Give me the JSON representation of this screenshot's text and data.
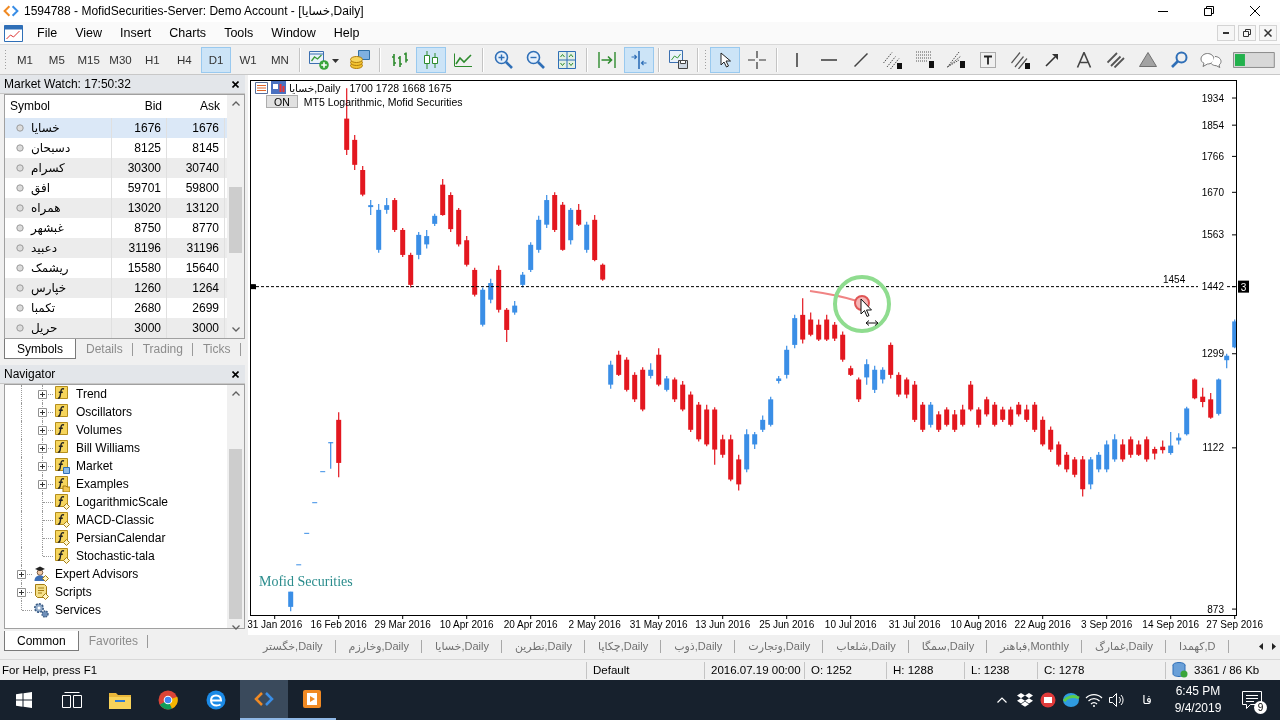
{
  "window": {
    "title": "1594788 - MofidSecurities-Server: Demo Account - [خسايا,Daily]"
  },
  "menu": [
    "File",
    "View",
    "Insert",
    "Charts",
    "Tools",
    "Window",
    "Help"
  ],
  "toolbar": {
    "timeframes": [
      {
        "label": "M1",
        "selected": false
      },
      {
        "label": "M5",
        "selected": false
      },
      {
        "label": "M15",
        "selected": false
      },
      {
        "label": "M30",
        "selected": false
      },
      {
        "label": "H1",
        "selected": false
      },
      {
        "label": "H4",
        "selected": false
      },
      {
        "label": "D1",
        "selected": true
      },
      {
        "label": "W1",
        "selected": false
      },
      {
        "label": "MN",
        "selected": false
      }
    ],
    "chart_types": [
      {
        "kind": "bars",
        "selected": false
      },
      {
        "kind": "candles",
        "selected": true
      },
      {
        "kind": "line",
        "selected": false
      }
    ],
    "scroll_modes": [
      {
        "kind": "autoscroll",
        "selected": false
      },
      {
        "kind": "shift",
        "selected": true
      }
    ],
    "cursor_modes": [
      {
        "kind": "cursor",
        "selected": true
      },
      {
        "kind": "crosshair",
        "selected": false
      }
    ]
  },
  "market_watch": {
    "title": "Market Watch: 17:50:32",
    "columns": [
      "Symbol",
      "Bid",
      "Ask"
    ],
    "rows": [
      {
        "symbol": "خسايا",
        "bid": "1676",
        "ask": "1676",
        "selected": true
      },
      {
        "symbol": "دسبحان",
        "bid": "8125",
        "ask": "8145",
        "selected": false
      },
      {
        "symbol": "كسرام",
        "bid": "30300",
        "ask": "30740",
        "selected": false
      },
      {
        "symbol": "افق",
        "bid": "59701",
        "ask": "59800",
        "selected": false
      },
      {
        "symbol": "همراه",
        "bid": "13020",
        "ask": "13120",
        "selected": false
      },
      {
        "symbol": "غبشهر",
        "bid": "8750",
        "ask": "8770",
        "selected": false
      },
      {
        "symbol": "دعبيد",
        "bid": "31196",
        "ask": "31196",
        "selected": false
      },
      {
        "symbol": "ريشمک",
        "bid": "15580",
        "ask": "15640",
        "selected": false
      },
      {
        "symbol": "خپارس",
        "bid": "1260",
        "ask": "1264",
        "selected": false
      },
      {
        "symbol": "تکمبا",
        "bid": "2680",
        "ask": "2699",
        "selected": false
      },
      {
        "symbol": "حريل",
        "bid": "3000",
        "ask": "3000",
        "selected": false
      }
    ],
    "tabs": [
      {
        "label": "Symbols",
        "selected": true
      },
      {
        "label": "Details",
        "selected": false
      },
      {
        "label": "Trading",
        "selected": false
      },
      {
        "label": "Ticks",
        "selected": false
      }
    ]
  },
  "navigator": {
    "title": "Navigator",
    "tree": [
      {
        "children": [
          {
            "label": "Trend",
            "kind": "group",
            "expanded": false
          },
          {
            "label": "Oscillators",
            "kind": "group",
            "expanded": false
          },
          {
            "label": "Volumes",
            "kind": "group",
            "expanded": false
          },
          {
            "label": "Bill Williams",
            "kind": "group",
            "expanded": false
          },
          {
            "label": "Market",
            "kind": "market",
            "expanded": false
          },
          {
            "label": "Examples",
            "kind": "examples",
            "expanded": false
          },
          {
            "label": "LogarithmicScale",
            "kind": "custom"
          },
          {
            "label": "MACD-Classic",
            "kind": "custom"
          },
          {
            "label": "PersianCalendar",
            "kind": "custom"
          },
          {
            "label": "Stochastic-tala",
            "kind": "custom"
          }
        ]
      },
      {
        "label": "Expert Advisors",
        "kind": "experts",
        "expanded": false
      },
      {
        "label": "Scripts",
        "kind": "scripts",
        "expanded": false
      },
      {
        "label": "Services",
        "kind": "services"
      }
    ],
    "tabs": [
      {
        "label": "Common",
        "selected": true
      },
      {
        "label": "Favorites",
        "selected": false
      }
    ]
  },
  "chart": {
    "header": {
      "symbol": "خسايا,Daily",
      "prices": "1700 1728 1668 1675"
    },
    "indicator": {
      "button": "ON",
      "label": "MT5 Logarithmic, Mofid Securities"
    },
    "label": "Mofid Securities",
    "line_tag": "3",
    "chart_data": [
      {
        "type": "candlestick",
        "log": true,
        "ylim": [
          865,
          1989
        ],
        "yticks": [
          873,
          1122,
          1299,
          1442,
          1563,
          1670,
          1766,
          1854,
          1934
        ],
        "ref_lines": [
          {
            "axis": "y",
            "value": 1442,
            "color": "#000000",
            "line_style": "dashed"
          }
        ],
        "annotations": [
          "1454"
        ],
        "categories": [
          null,
          null,
          null,
          "31 Jan 2016",
          null,
          null,
          null,
          null,
          null,
          null,
          null,
          "16 Feb 2016",
          null,
          null,
          null,
          null,
          null,
          null,
          null,
          "29 Mar 2016",
          null,
          null,
          null,
          null,
          null,
          null,
          null,
          "10 Apr 2016",
          null,
          null,
          null,
          null,
          null,
          null,
          null,
          "20 Apr 2016",
          null,
          null,
          null,
          null,
          null,
          null,
          null,
          "2 May 2016",
          null,
          null,
          null,
          null,
          null,
          null,
          null,
          "31 May 2016",
          null,
          null,
          null,
          null,
          null,
          null,
          null,
          "13 Jun 2016",
          null,
          null,
          null,
          null,
          null,
          null,
          null,
          "25 Jun 2016",
          null,
          null,
          null,
          null,
          null,
          null,
          null,
          "10 Jul 2016",
          null,
          null,
          null,
          null,
          null,
          null,
          null,
          "31 Jul 2016",
          null,
          null,
          null,
          null,
          null,
          null,
          null,
          "10 Aug 2016",
          null,
          null,
          null,
          null,
          null,
          null,
          null,
          "22 Aug 2016",
          null,
          null,
          null,
          null,
          null,
          null,
          null,
          "3 Sep 2016",
          null,
          null,
          null,
          null,
          null,
          null,
          null,
          "14 Sep 2016",
          null,
          null,
          null,
          null,
          null,
          null,
          null,
          "27 Sep 2016"
        ],
        "ohlc": [
          null,
          null,
          null,
          null,
          null,
          [
            876,
            897,
            870,
            897
          ],
          [
            936,
            936,
            936,
            936
          ],
          [
            983,
            983,
            983,
            983
          ],
          [
            1031,
            1031,
            1031,
            1031
          ],
          [
            1082,
            1082,
            1082,
            1082
          ],
          [
            1130,
            1132,
            1086,
            1132
          ],
          [
            1172,
            1186,
            1072,
            1096
          ],
          [
            1873,
            1964,
            1770,
            1784
          ],
          [
            1812,
            1826,
            1729,
            1743
          ],
          [
            1729,
            1740,
            1660,
            1664
          ],
          [
            1632,
            1650,
            1612,
            1637
          ],
          [
            1527,
            1640,
            1520,
            1625
          ],
          [
            1625,
            1655,
            1615,
            1637
          ],
          [
            1650,
            1655,
            1570,
            1575
          ],
          [
            1575,
            1580,
            1510,
            1515
          ],
          [
            1515,
            1520,
            1440,
            1446
          ],
          [
            1515,
            1570,
            1505,
            1563
          ],
          [
            1540,
            1575,
            1530,
            1560
          ],
          [
            1590,
            1615,
            1585,
            1610
          ],
          [
            1690,
            1705,
            1610,
            1612
          ],
          [
            1663,
            1670,
            1570,
            1577
          ],
          [
            1625,
            1630,
            1535,
            1540
          ],
          [
            1550,
            1560,
            1488,
            1492
          ],
          [
            1480,
            1485,
            1420,
            1424
          ],
          [
            1359,
            1440,
            1355,
            1435
          ],
          [
            1413,
            1460,
            1405,
            1450
          ],
          [
            1480,
            1490,
            1385,
            1391
          ],
          [
            1391,
            1395,
            1323,
            1348
          ],
          [
            1385,
            1410,
            1380,
            1400
          ],
          [
            1446,
            1475,
            1440,
            1469
          ],
          [
            1480,
            1545,
            1475,
            1539
          ],
          [
            1527,
            1610,
            1520,
            1600
          ],
          [
            1588,
            1663,
            1580,
            1650
          ],
          [
            1663,
            1670,
            1570,
            1575
          ],
          [
            1638,
            1645,
            1525,
            1527
          ],
          [
            1550,
            1630,
            1540,
            1625
          ],
          [
            1625,
            1640,
            1585,
            1588
          ],
          [
            1527,
            1595,
            1520,
            1588
          ],
          [
            1600,
            1612,
            1500,
            1503
          ],
          [
            1492,
            1495,
            1455,
            1458
          ],
          [
            1238,
            1285,
            1230,
            1277
          ],
          [
            1297,
            1305,
            1255,
            1257
          ],
          [
            1287,
            1292,
            1225,
            1228
          ],
          [
            1257,
            1262,
            1205,
            1210
          ],
          [
            1267,
            1272,
            1188,
            1191
          ],
          [
            1255,
            1280,
            1250,
            1267
          ],
          [
            1297,
            1310,
            1235,
            1238
          ],
          [
            1228,
            1255,
            1225,
            1250
          ],
          [
            1248,
            1252,
            1205,
            1210
          ],
          [
            1238,
            1245,
            1188,
            1191
          ],
          [
            1219,
            1225,
            1150,
            1154
          ],
          [
            1200,
            1205,
            1133,
            1137
          ],
          [
            1191,
            1200,
            1125,
            1128
          ],
          [
            1191,
            1195,
            1093,
            1119
          ],
          [
            1137,
            1145,
            1105,
            1110
          ],
          [
            1137,
            1145,
            1065,
            1068
          ],
          [
            1102,
            1110,
            1050,
            1060
          ],
          [
            1085,
            1155,
            1080,
            1146
          ],
          [
            1128,
            1150,
            1120,
            1146
          ],
          [
            1154,
            1180,
            1150,
            1172
          ],
          [
            1163,
            1215,
            1160,
            1210
          ],
          [
            1245,
            1255,
            1240,
            1250
          ],
          [
            1257,
            1315,
            1250,
            1307
          ],
          [
            1317,
            1380,
            1310,
            1373
          ],
          [
            1380,
            1416,
            1320,
            1328
          ],
          [
            1370,
            1385,
            1335,
            1338
          ],
          [
            1359,
            1370,
            1325,
            1328
          ],
          [
            1370,
            1380,
            1325,
            1328
          ],
          [
            1359,
            1365,
            1325,
            1330
          ],
          [
            1338,
            1345,
            1283,
            1287
          ],
          [
            1270,
            1275,
            1255,
            1257
          ],
          [
            1248,
            1252,
            1205,
            1210
          ],
          [
            1252,
            1288,
            1238,
            1278
          ],
          [
            1228,
            1275,
            1222,
            1267
          ],
          [
            1248,
            1272,
            1240,
            1267
          ],
          [
            1317,
            1322,
            1250,
            1257
          ],
          [
            1257,
            1262,
            1215,
            1219
          ],
          [
            1248,
            1252,
            1212,
            1219
          ],
          [
            1238,
            1245,
            1168,
            1172
          ],
          [
            1200,
            1205,
            1150,
            1154
          ],
          [
            1163,
            1205,
            1158,
            1200
          ],
          [
            1182,
            1188,
            1150,
            1154
          ],
          [
            1191,
            1195,
            1160,
            1163
          ],
          [
            1182,
            1190,
            1150,
            1154
          ],
          [
            1191,
            1200,
            1160,
            1163
          ],
          [
            1238,
            1245,
            1188,
            1191
          ],
          [
            1191,
            1195,
            1158,
            1163
          ],
          [
            1210,
            1215,
            1178,
            1182
          ],
          [
            1200,
            1205,
            1160,
            1163
          ],
          [
            1191,
            1196,
            1168,
            1172
          ],
          [
            1191,
            1196,
            1160,
            1163
          ],
          [
            1200,
            1205,
            1178,
            1182
          ],
          [
            1191,
            1200,
            1168,
            1172
          ],
          [
            1200,
            1205,
            1150,
            1154
          ],
          [
            1172,
            1178,
            1125,
            1128
          ],
          [
            1154,
            1160,
            1115,
            1119
          ],
          [
            1128,
            1133,
            1090,
            1093
          ],
          [
            1110,
            1115,
            1080,
            1085
          ],
          [
            1102,
            1106,
            1072,
            1076
          ],
          [
            1102,
            1108,
            1040,
            1052
          ],
          [
            1060,
            1106,
            1052,
            1102
          ],
          [
            1085,
            1115,
            1080,
            1110
          ],
          [
            1085,
            1135,
            1080,
            1128
          ],
          [
            1102,
            1146,
            1098,
            1137
          ],
          [
            1128,
            1137,
            1098,
            1102
          ],
          [
            1137,
            1142,
            1105,
            1110
          ],
          [
            1128,
            1135,
            1108,
            1110
          ],
          [
            1137,
            1142,
            1098,
            1102
          ],
          [
            1120,
            1124,
            1102,
            1112
          ],
          [
            1124,
            1135,
            1112,
            1118
          ],
          [
            1113,
            1150,
            1110,
            1126
          ],
          [
            1135,
            1148,
            1128,
            1140
          ],
          [
            1146,
            1196,
            1144,
            1193
          ],
          [
            1248,
            1250,
            1210,
            1212
          ],
          [
            1215,
            1232,
            1195,
            1205
          ],
          [
            1210,
            1222,
            1174,
            1176
          ],
          [
            1183,
            1250,
            1180,
            1248
          ],
          [
            1286,
            1299,
            1270,
            1295
          ],
          [
            1312,
            1370,
            1310,
            1366
          ]
        ]
      }
    ]
  },
  "chart_tabs": [
    "خگستر,Daily",
    "وخارزم,Daily",
    "خسايا,Daily",
    "نطرين,Daily",
    "چكاپا,Daily",
    "ذوب,Daily",
    "وتجارت,Daily",
    "شلعاب,Daily",
    "سمگا,Daily",
    "فباهنر,Monthly",
    "غمارگ,Daily",
    "كهمدا,D"
  ],
  "status_bar": {
    "help": "For Help, press F1",
    "profile": "Default",
    "time": "2016.07.19 00:00",
    "open": "O: 1252",
    "high": "H: 1288",
    "low": "L: 1238",
    "close": "C: 1278",
    "traffic": "3361 / 86 Kb"
  },
  "taskbar": {
    "apps": [
      {
        "kind": "explorer",
        "running": false,
        "active": false
      },
      {
        "kind": "browser",
        "running": false,
        "active": false
      },
      {
        "kind": "edge",
        "running": false,
        "active": false
      },
      {
        "kind": "terminal",
        "running": true,
        "active": true
      },
      {
        "kind": "player",
        "running": true,
        "active": false
      }
    ],
    "language": "فا",
    "time": "6:45 PM",
    "date": "9/4/2019",
    "notifications": "9"
  }
}
